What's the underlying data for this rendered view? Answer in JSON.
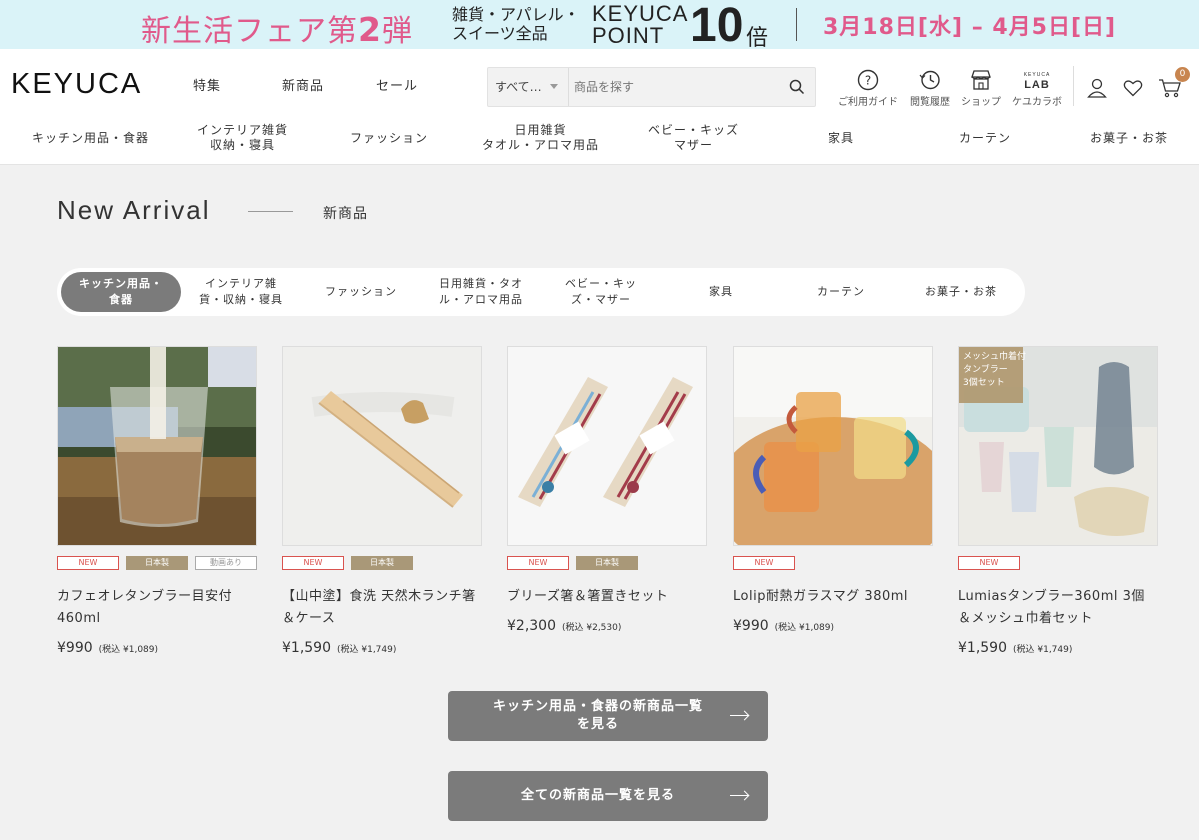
{
  "promo": {
    "main_pre": "新生活フェア第",
    "main_num": "2",
    "main_post": "弾",
    "sub_line1": "雑貨・アパレル・",
    "sub_line2": "スイーツ全品",
    "brand_line1": "KEYUCA",
    "brand_line2": "POINT",
    "multiplier": "10",
    "multiplier_unit": "倍",
    "dates": "3月18日[水] – 4月5日[日]"
  },
  "header": {
    "logo": "KEYUCA",
    "nav": [
      "特集",
      "新商品",
      "セール"
    ],
    "search": {
      "category": "すべて…",
      "placeholder": "商品を探す"
    },
    "icons": [
      {
        "label": "ご利用ガイド",
        "icon": "help-icon"
      },
      {
        "label": "閲覧履歴",
        "icon": "history-icon"
      },
      {
        "label": "ショップ",
        "icon": "shop-icon"
      },
      {
        "label": "ケユカラボ",
        "icon": "keyuca-lab-icon",
        "logo_small": "KEYUCA",
        "logo_big": "LAB"
      }
    ],
    "cart_count": "0",
    "categories": [
      "キッチン用品・食器",
      "インテリア雑貨\n収納・寝具",
      "ファッション",
      "日用雑貨\nタオル・アロマ用品",
      "ベビー・キッズ\nマザー",
      "家具",
      "カーテン",
      "お菓子・お茶"
    ]
  },
  "section": {
    "title_en": "New Arrival",
    "title_jp": "新商品"
  },
  "tabs": [
    "キッチン用品・\n食器",
    "インテリア雑\n貨・収納・寝具",
    "ファッション",
    "日用雑貨・タオ\nル・アロマ用品",
    "ベビー・キッ\nズ・マザー",
    "家具",
    "カーテン",
    "お菓子・お茶"
  ],
  "active_tab": 0,
  "products": [
    {
      "name": "カフェオレタンブラー目安付 460ml",
      "price": "¥990",
      "tax": "(税込 ¥1,089)",
      "tags": [
        "NEW",
        "日本製",
        "動画あり"
      ]
    },
    {
      "name": "【山中塗】食洗 天然木ランチ箸＆ケース",
      "price": "¥1,590",
      "tax": "(税込 ¥1,749)",
      "tags": [
        "NEW",
        "日本製"
      ]
    },
    {
      "name": "ブリーズ箸＆箸置きセット",
      "price": "¥2,300",
      "tax": "(税込 ¥2,530)",
      "tags": [
        "NEW",
        "日本製"
      ]
    },
    {
      "name": "Lolip耐熱ガラスマグ 380ml",
      "price": "¥990",
      "tax": "(税込 ¥1,089)",
      "tags": [
        "NEW"
      ]
    },
    {
      "name": "Lumiasタンブラー360ml 3個＆メッシュ巾着セット",
      "price": "¥1,590",
      "tax": "(税込 ¥1,749)",
      "tags": [
        "NEW"
      ],
      "image_label": "メッシュ巾着付\nタンブラー\n3個セット"
    }
  ],
  "buttons": {
    "category_list": "キッチン用品・食器の新商品一覧を見る",
    "all_list": "全ての新商品一覧を見る"
  },
  "colors": {
    "promo_bg": "#daf3f8",
    "promo_pink": "#e05a8b",
    "button_gray": "#7b7b7b",
    "new_red": "#d9534f",
    "made_in_japan_tan": "#a99878",
    "badge": "#c8854f"
  }
}
